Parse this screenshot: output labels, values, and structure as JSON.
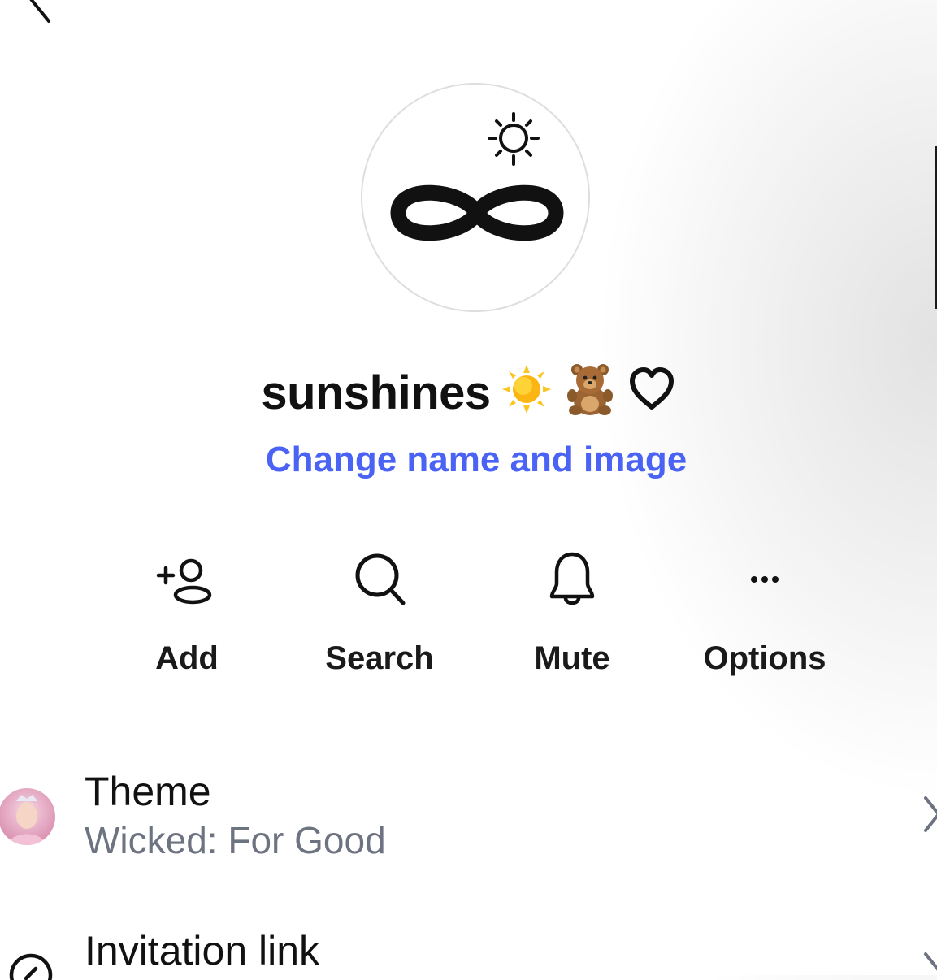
{
  "header": {
    "back_icon": "chevron-left-icon"
  },
  "group": {
    "avatar_icon": "infinity-sun-icon",
    "name": "sunshines",
    "name_emojis": [
      "sun-emoji",
      "teddy-bear-emoji",
      "heart-outline-icon"
    ],
    "change_link": "Change name and image"
  },
  "actions": [
    {
      "label": "Add",
      "icon": "add-person-icon"
    },
    {
      "label": "Search",
      "icon": "search-icon"
    },
    {
      "label": "Mute",
      "icon": "bell-icon"
    },
    {
      "label": "Options",
      "icon": "more-dots-icon"
    }
  ],
  "settings": [
    {
      "title": "Theme",
      "subtitle": "Wicked: For Good",
      "icon": "theme-thumbnail"
    },
    {
      "title": "Invitation link",
      "icon": "link-icon"
    }
  ],
  "colors": {
    "accent": "#4a63f5",
    "subtitle": "#6d7380"
  }
}
